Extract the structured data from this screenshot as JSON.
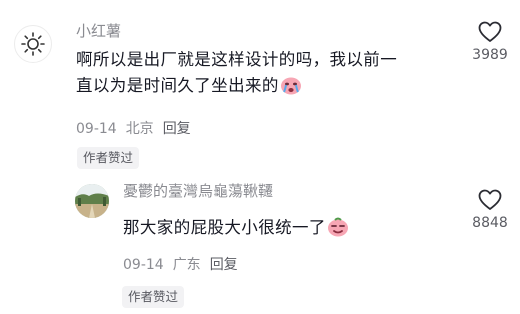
{
  "comments": [
    {
      "author": "小红薯",
      "text_line1": "啊所以是出厂就是这样设计的吗，我以前一",
      "text_line2": "直以为是时间久了坐出来的",
      "date": "09-14",
      "location": "北京",
      "reply_label": "回复",
      "badge": "作者赞过",
      "likes": "3989",
      "avatar_icon": "sun-icon",
      "emoji_icon": "crying-face-emoji"
    },
    {
      "author": "憂鬱的臺灣烏龜蕩鞦韆",
      "text": "那大家的屁股大小很统一了",
      "date": "09-14",
      "location": "广东",
      "reply_label": "回复",
      "badge": "作者赞过",
      "likes": "8848",
      "avatar_icon": "landscape-photo-avatar",
      "emoji_icon": "smirk-face-emoji"
    }
  ],
  "colors": {
    "text_primary": "#161823",
    "text_secondary": "#8a8b91",
    "chip_bg": "#f2f2f4",
    "emoji_pink": "#f7a6b4"
  }
}
